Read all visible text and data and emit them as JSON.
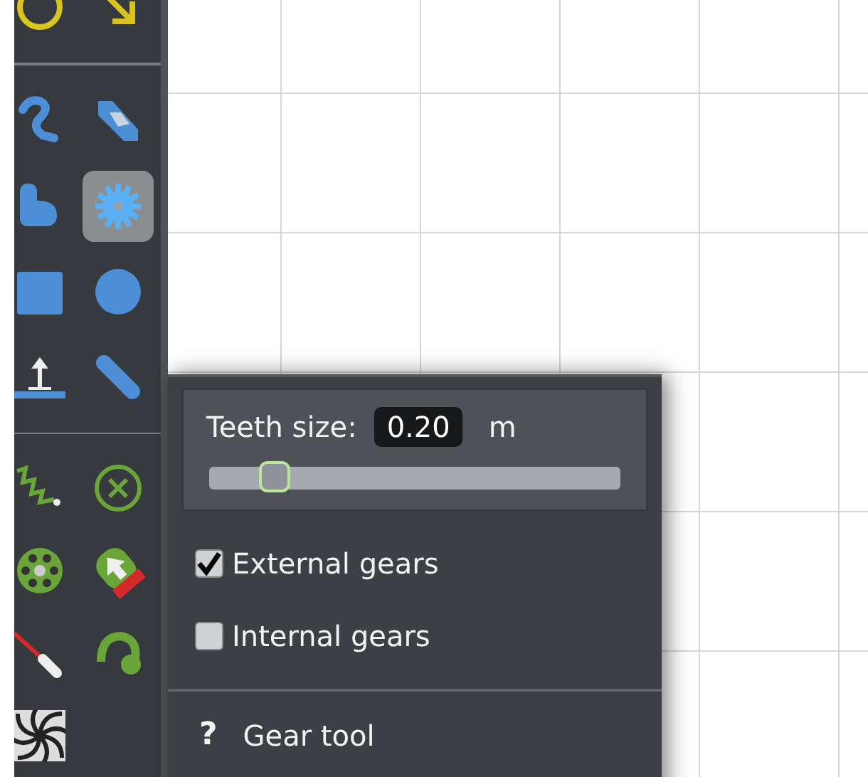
{
  "toolbar": {
    "groups": [
      {
        "tools": [
          {
            "kind": "ring",
            "selected": false
          },
          {
            "kind": "arrow",
            "selected": false
          }
        ]
      },
      {
        "tools": [
          {
            "kind": "hook",
            "selected": false
          },
          {
            "kind": "eraser",
            "selected": false
          },
          {
            "kind": "blob",
            "selected": false
          },
          {
            "kind": "gear",
            "selected": true
          },
          {
            "kind": "square",
            "selected": false
          },
          {
            "kind": "circle",
            "selected": false
          },
          {
            "kind": "anchor",
            "selected": false
          },
          {
            "kind": "capsule",
            "selected": false
          }
        ]
      },
      {
        "tools": [
          {
            "kind": "spring",
            "selected": false
          },
          {
            "kind": "cross",
            "selected": false
          },
          {
            "kind": "wheel",
            "selected": false
          },
          {
            "kind": "pointer",
            "selected": false
          },
          {
            "kind": "rod",
            "selected": false
          },
          {
            "kind": "hinge",
            "selected": false
          },
          {
            "kind": "spiral",
            "selected": false
          }
        ]
      }
    ]
  },
  "panel": {
    "teeth_size": {
      "label": "Teeth size:",
      "value": "0.20",
      "unit": "m",
      "level": 0.16
    },
    "options": [
      {
        "label": "External gears",
        "checked": true
      },
      {
        "label": "Internal gears",
        "checked": false
      }
    ],
    "help": {
      "icon": "?",
      "label": "Gear tool"
    }
  }
}
